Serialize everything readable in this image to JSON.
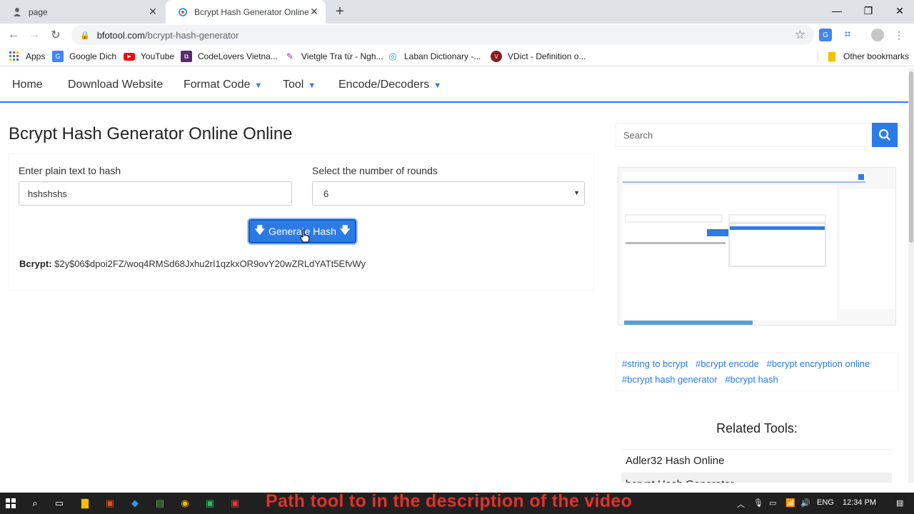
{
  "browser": {
    "tabs": [
      {
        "title": "page",
        "active": false
      },
      {
        "title": "Bcrypt Hash Generator Online Or",
        "active": true
      }
    ],
    "url_host": "bfotool.com",
    "url_path": "/bcrypt-hash-generator",
    "bookmarks": [
      {
        "label": "Apps",
        "icon": "apps-grid-icon"
      },
      {
        "label": "Google Dich",
        "icon": "google-translate-icon"
      },
      {
        "label": "YouTube",
        "icon": "youtube-icon"
      },
      {
        "label": "CodeLovers Vietna...",
        "icon": "codelovers-icon"
      },
      {
        "label": "Vietgle Tra từ - Ngh...",
        "icon": "vietgle-icon"
      },
      {
        "label": "Laban Dictionary -...",
        "icon": "laban-icon"
      },
      {
        "label": "VDict - Definition o...",
        "icon": "vdict-icon"
      }
    ],
    "other_bookmarks": "Other bookmarks"
  },
  "site_nav": {
    "home": "Home",
    "download": "Download Website",
    "format": "Format Code",
    "tool": "Tool",
    "encode": "Encode/Decoders"
  },
  "main": {
    "title": "Bcrypt Hash Generator Online Online",
    "plain_label": "Enter plain text to hash",
    "plain_value": "hshshshs",
    "rounds_label": "Select the number of rounds",
    "rounds_value": "6",
    "generate_label": "Generate Hash",
    "result_label": "Bcrypt:",
    "result_value": "$2y$06$dpoi2FZ/woq4RMSd68Jxhu2rI1qzkxOR9ovY20wZRLdYATt5EfvWy"
  },
  "sidebar": {
    "search_placeholder": "Search",
    "tags": [
      "#string to bcrypt",
      "#bcrypt encode",
      "#bcrypt encryption online",
      "#bcrypt hash generator",
      "#bcrypt hash"
    ],
    "related_title": "Related Tools:",
    "related": [
      "Adler32 Hash Online",
      "bcrypt Hash Generator"
    ]
  },
  "taskbar": {
    "overlay_text": "Path tool to in the description of the video",
    "lang": "ENG",
    "time": "12:34 PM"
  },
  "colors": {
    "accent": "#2c7be5",
    "overlay_red": "#e0332b"
  }
}
